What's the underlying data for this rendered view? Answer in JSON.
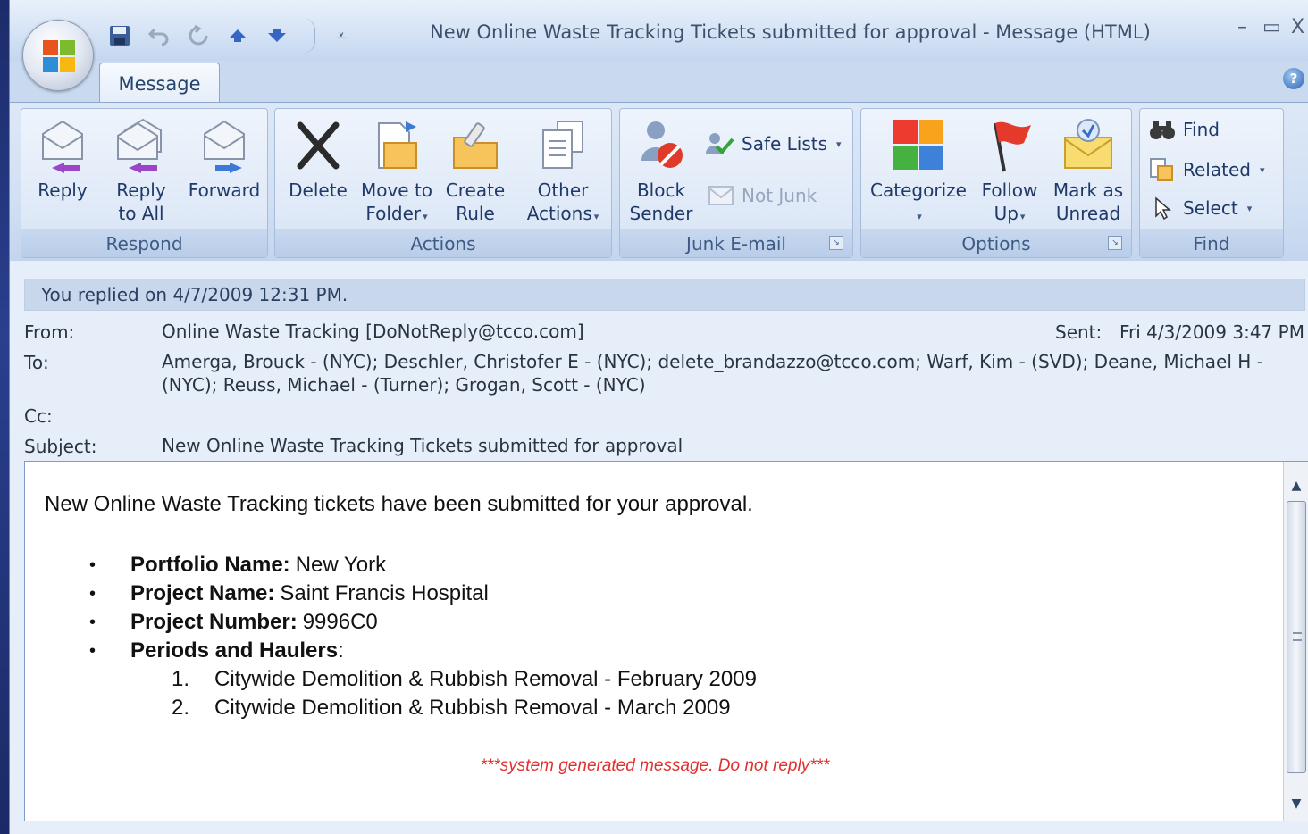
{
  "window": {
    "title": "New Online Waste Tracking Tickets submitted for approval - Message (HTML)",
    "min": "–",
    "max": "▭",
    "close": "X"
  },
  "tabs": [
    {
      "label": "Message",
      "active": true
    }
  ],
  "help_label": "?",
  "ribbon": {
    "respond": {
      "label": "Respond",
      "buttons": [
        {
          "line1": "Reply",
          "line2": ""
        },
        {
          "line1": "Reply",
          "line2": "to All"
        },
        {
          "line1": "Forward",
          "line2": ""
        }
      ]
    },
    "actions": {
      "label": "Actions",
      "buttons": [
        {
          "line1": "Delete",
          "line2": ""
        },
        {
          "line1": "Move to",
          "line2": "Folder"
        },
        {
          "line1": "Create",
          "line2": "Rule"
        },
        {
          "line1": "Other",
          "line2": "Actions"
        }
      ]
    },
    "junk": {
      "label": "Junk E-mail",
      "block": {
        "line1": "Block",
        "line2": "Sender"
      },
      "safe_lists": "Safe Lists",
      "not_junk": "Not Junk"
    },
    "options": {
      "label": "Options",
      "buttons": [
        {
          "line1": "Categorize",
          "line2": ""
        },
        {
          "line1": "Follow",
          "line2": "Up"
        },
        {
          "line1": "Mark as",
          "line2": "Unread"
        }
      ]
    },
    "find": {
      "label": "Find",
      "find": "Find",
      "related": "Related",
      "select": "Select"
    },
    "drop_arrow": "▾",
    "launcher": "↘"
  },
  "message": {
    "info_bar": "You replied on 4/7/2009 12:31 PM.",
    "from_label": "From:",
    "from": "Online Waste Tracking [DoNotReply@tcco.com]",
    "sent_label": "Sent:",
    "sent": "Fri 4/3/2009 3:47 PM",
    "to_label": "To:",
    "to": "Amerga, Brouck - (NYC); Deschler, Christofer E - (NYC); delete_brandazzo@tcco.com; Warf, Kim - (SVD); Deane, Michael H - (NYC); Reuss, Michael - (Turner); Grogan, Scott - (NYC)",
    "cc_label": "Cc:",
    "cc": "",
    "subject_label": "Subject:",
    "subject": "New Online Waste Tracking Tickets submitted for approval"
  },
  "body": {
    "intro": "New Online Waste Tracking tickets have been submitted for your approval.",
    "bullet_char": "•",
    "bullets": [
      {
        "label": "Portfolio Name:",
        "value": "New York"
      },
      {
        "label": "Project Name:",
        "value": "Saint Francis Hospital"
      },
      {
        "label": "Project Number:",
        "value": "9996C0"
      },
      {
        "label": "Periods and Haulers",
        "value": ":"
      }
    ],
    "periods": [
      {
        "n": "1.",
        "text": "Citywide Demolition & Rubbish Removal - February 2009"
      },
      {
        "n": "2.",
        "text": "Citywide Demolition & Rubbish Removal - March 2009"
      }
    ],
    "system_note": "***system generated message. Do not reply***"
  },
  "scrollbar": {
    "up": "▲",
    "down": "▼"
  },
  "colors": {
    "accent": "#1f3a68",
    "system_note": "#e03030",
    "ribbon": "#d1e0f3"
  }
}
